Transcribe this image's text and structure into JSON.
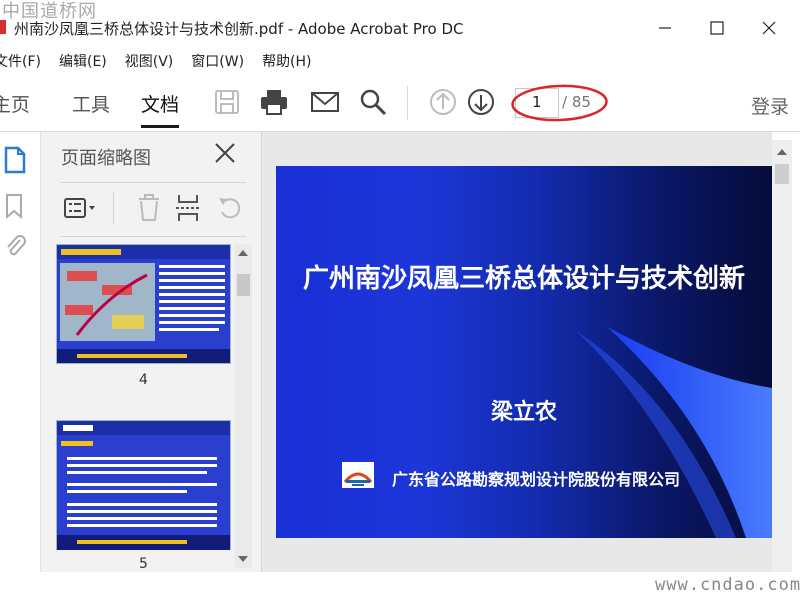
{
  "window": {
    "title": "州南沙凤凰三桥总体设计与技术创新.pdf - Adobe Acrobat Pro DC",
    "watermark_top": "中国道桥网",
    "watermark_bottom": "www.cndao.com"
  },
  "menu": [
    "文件(F)",
    "编辑(E)",
    "视图(V)",
    "窗口(W)",
    "帮助(H)"
  ],
  "toolbar": {
    "tab_home": "主页",
    "tab_tools": "工具",
    "tab_document": "文档",
    "page_current": "1",
    "page_total": "/ 85",
    "login": "登录",
    "icons": [
      "save-icon",
      "print-icon",
      "email-icon",
      "search-icon",
      "page-up-icon",
      "page-down-icon"
    ]
  },
  "thumbnail_panel": {
    "title": "页面缩略图",
    "thumbnails": [
      {
        "label": "4"
      },
      {
        "label": "5"
      }
    ]
  },
  "slide": {
    "title": "广州南沙凤凰三桥总体设计与技术创新",
    "author": "梁立农",
    "organization": "广东省公路勘察规划设计院股份有限公司"
  },
  "colors": {
    "slide_blue": "#1c36d8",
    "annotation_red": "#d9262a"
  }
}
